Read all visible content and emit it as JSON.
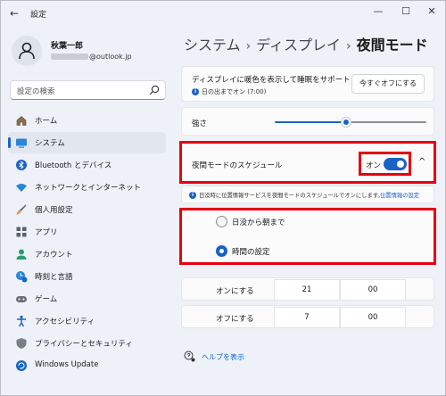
{
  "window": {
    "title": "設定",
    "back_glyph": "←",
    "min_glyph": "—",
    "max_glyph": "☐",
    "close_glyph": "✕"
  },
  "user": {
    "name": "秋葉一郎",
    "email_domain": "@outlook.jp"
  },
  "search": {
    "placeholder": "設定の検索"
  },
  "sidebar": {
    "items": [
      {
        "label": "ホーム",
        "icon": "home-icon"
      },
      {
        "label": "システム",
        "icon": "system-icon",
        "active": true
      },
      {
        "label": "Bluetooth とデバイス",
        "icon": "bluetooth-icon"
      },
      {
        "label": "ネットワークとインターネット",
        "icon": "wifi-icon"
      },
      {
        "label": "個人用設定",
        "icon": "brush-icon"
      },
      {
        "label": "アプリ",
        "icon": "apps-icon"
      },
      {
        "label": "アカウント",
        "icon": "account-icon"
      },
      {
        "label": "時刻と言語",
        "icon": "time-language-icon"
      },
      {
        "label": "ゲーム",
        "icon": "gaming-icon"
      },
      {
        "label": "アクセシビリティ",
        "icon": "accessibility-icon"
      },
      {
        "label": "プライバシーとセキュリティ",
        "icon": "shield-icon"
      },
      {
        "label": "Windows Update",
        "icon": "windows-update-icon"
      }
    ]
  },
  "breadcrumb": {
    "part1": "システム",
    "part2": "ディスプレイ",
    "current": "夜間モード",
    "sep": "›"
  },
  "sunset_card": {
    "text": "ディスプレイに暖色を表示して睡眠をサポート",
    "subtext": "日の出までオン (7:00)",
    "button": "今すぐオフにする"
  },
  "strength": {
    "label": "強さ",
    "value_percent": 48
  },
  "schedule": {
    "label": "夜間モードのスケジュール",
    "toggle_label": "オン",
    "toggle_on": true,
    "chevron": "^",
    "note": "日没時に位置情報サービスを夜間モードのスケジュールでオンにします。",
    "note_link": "位置情報の設定"
  },
  "options": {
    "sunset_to_sunrise": "日没から朝まで",
    "set_hours": "時間の設定",
    "selected": "時間の設定"
  },
  "times": {
    "on_label": "オンにする",
    "on_hour": "21",
    "on_minute": "00",
    "off_label": "オフにする",
    "off_hour": "7",
    "off_minute": "00"
  },
  "help": {
    "label": "ヘルプを表示"
  },
  "colors": {
    "accent": "#1a62c5",
    "highlight": "#e60012"
  }
}
